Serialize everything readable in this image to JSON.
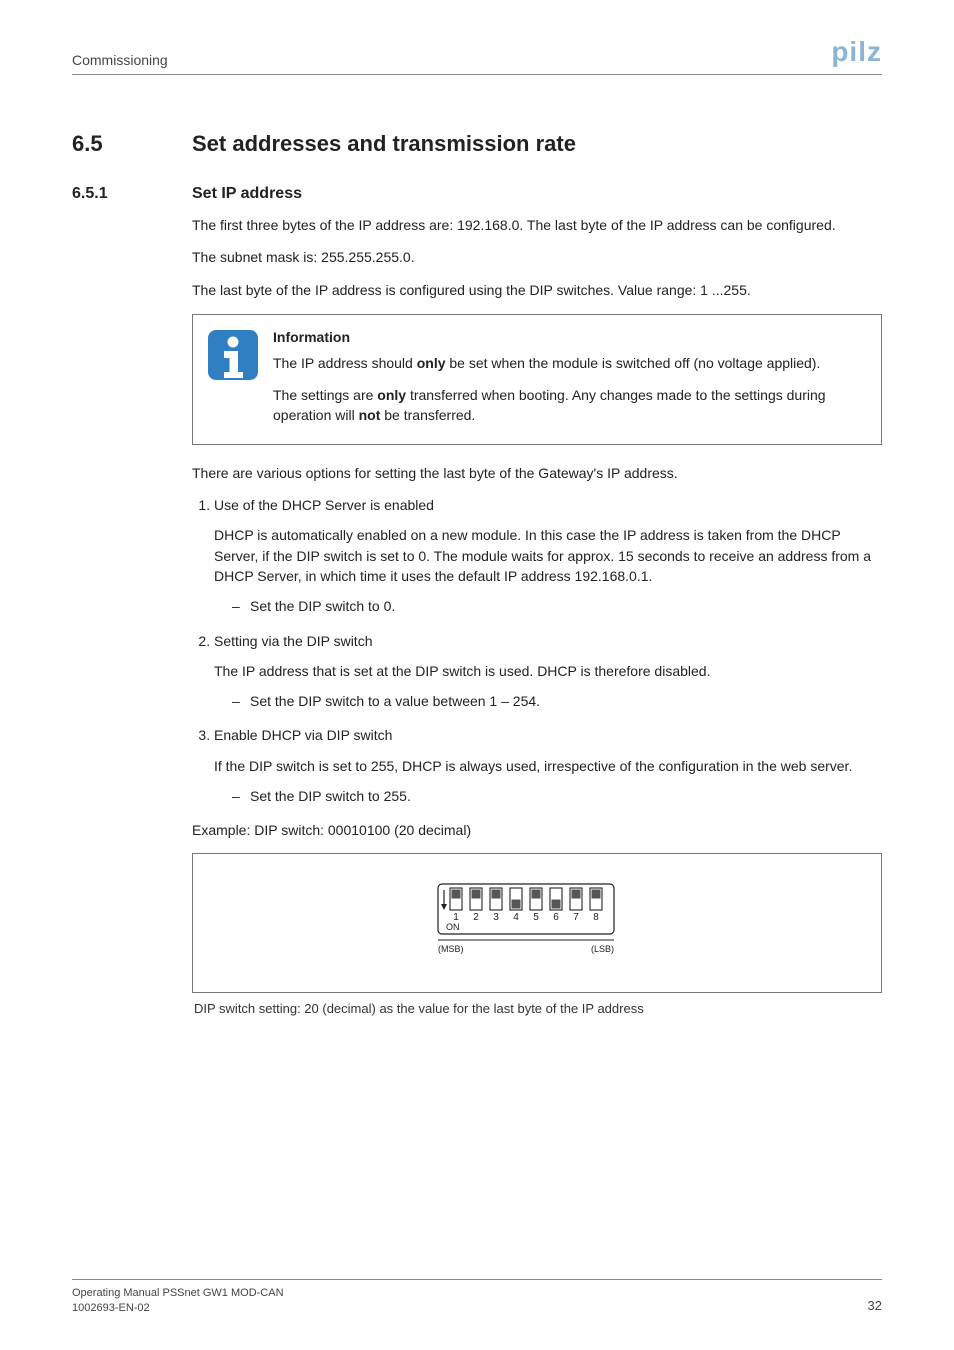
{
  "header": {
    "section": "Commissioning",
    "logo": "pilz"
  },
  "sec65": {
    "num": "6.5",
    "title": "Set addresses and transmission rate"
  },
  "sec651": {
    "num": "6.5.1",
    "title": "Set IP address",
    "p1": "The first three bytes of the IP address are: 192.168.0. The last byte of the IP address can be configured.",
    "p2": "The subnet mask is: 255.255.255.0.",
    "p3": "The last byte of the IP address is configured using the DIP switches. Value range: 1 ...255."
  },
  "info": {
    "title": "Information",
    "p1a": "The IP address should ",
    "p1b": "only",
    "p1c": " be set when the module is switched off (no voltage applied).",
    "p2a": "The settings are ",
    "p2b": "only",
    "p2c": " transferred when booting. Any changes made to the settings during operation will ",
    "p2d": "not",
    "p2e": " be transferred."
  },
  "afterInfo": "There are various options for setting the last byte of the Gateway's IP address.",
  "list": {
    "i1": {
      "head": "Use of the DHCP Server is enabled",
      "para": "DHCP is automatically enabled on a new module. In this case the IP address is taken from the DHCP Server, if the DIP switch is set to 0. The module waits for approx. 15 seconds to receive an address from a DHCP Server, in which time it uses the default IP address 192.168.0.1.",
      "sub1": "Set the DIP switch to 0."
    },
    "i2": {
      "head": "Setting via the DIP switch",
      "para": "The IP address that is set at the DIP switch is used. DHCP is therefore disabled.",
      "sub1": "Set the DIP switch to a value between 1 – 254."
    },
    "i3": {
      "head": "Enable DHCP via DIP switch",
      "para": "If the DIP switch is set to 255, DHCP is always used, irrespective of the configuration in the web server.",
      "sub1": "Set the DIP switch to 255."
    }
  },
  "example": "Example: DIP switch: 00010100 (20 decimal)",
  "fig": {
    "on": "ON",
    "msb": "(MSB)",
    "lsb": "(LSB)",
    "n1": "1",
    "n2": "2",
    "n3": "3",
    "n4": "4",
    "n5": "5",
    "n6": "6",
    "n7": "7",
    "n8": "8"
  },
  "caption": "DIP switch setting: 20 (decimal) as the value for the last byte of the IP address",
  "footer": {
    "l1": "Operating Manual PSSnet GW1 MOD-CAN",
    "l2": "1002693-EN-02",
    "page": "32"
  }
}
